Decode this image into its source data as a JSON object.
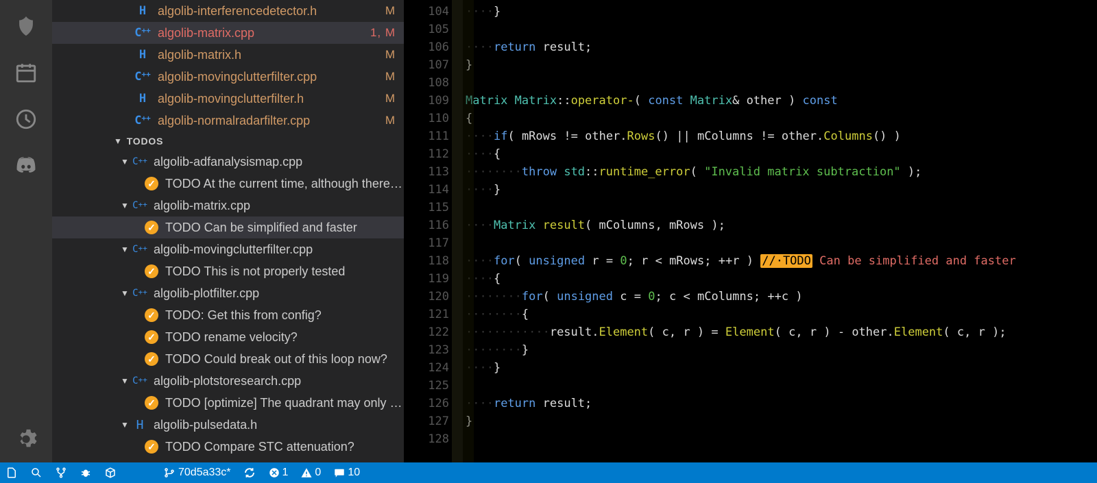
{
  "files": [
    {
      "icon": "H",
      "name": "algolib-interferencedetector.h",
      "status": "M",
      "kind": "h",
      "indent": 120,
      "active": false
    },
    {
      "icon": "C++",
      "name": "algolib-matrix.cpp",
      "status": "1, M",
      "kind": "cpp",
      "indent": 120,
      "active": true
    },
    {
      "icon": "H",
      "name": "algolib-matrix.h",
      "status": "M",
      "kind": "h",
      "indent": 120,
      "active": false
    },
    {
      "icon": "C++",
      "name": "algolib-movingclutterfilter.cpp",
      "status": "M",
      "kind": "cpp",
      "indent": 120,
      "active": false
    },
    {
      "icon": "H",
      "name": "algolib-movingclutterfilter.h",
      "status": "M",
      "kind": "h",
      "indent": 120,
      "active": false
    },
    {
      "icon": "C++",
      "name": "algolib-normalradarfilter.cpp",
      "status": "M",
      "kind": "cpp",
      "indent": 120,
      "active": false
    }
  ],
  "section_todos": "TODOS",
  "todo_groups": [
    {
      "icon": "C++",
      "name": "algolib-adfanalysismap.cpp",
      "items": [
        {
          "text": "TODO At the current time, although there is s…",
          "sel": false
        }
      ]
    },
    {
      "icon": "C++",
      "name": "algolib-matrix.cpp",
      "items": [
        {
          "text": "TODO Can be simplified and faster",
          "sel": true
        }
      ]
    },
    {
      "icon": "C++",
      "name": "algolib-movingclutterfilter.cpp",
      "items": [
        {
          "text": "TODO This is not properly tested",
          "sel": false
        }
      ]
    },
    {
      "icon": "C++",
      "name": "algolib-plotfilter.cpp",
      "items": [
        {
          "text": "TODO: Get this from config?",
          "sel": false
        },
        {
          "text": "TODO rename velocity?",
          "sel": false
        },
        {
          "text": "TODO Could break out of this loop now?",
          "sel": false
        }
      ]
    },
    {
      "icon": "C++",
      "name": "algolib-plotstoresearch.cpp",
      "items": [
        {
          "text": "TODO [optimize] The quadrant may only need…",
          "sel": false
        }
      ]
    },
    {
      "icon": "H",
      "name": "algolib-pulsedata.h",
      "items": [
        {
          "text": "TODO Compare STC attenuation?",
          "sel": false
        }
      ]
    }
  ],
  "line_start": 104,
  "line_count": 25,
  "status": {
    "branch": "70d5a33c*",
    "errors": "1",
    "warnings": "0",
    "comments": "10"
  }
}
